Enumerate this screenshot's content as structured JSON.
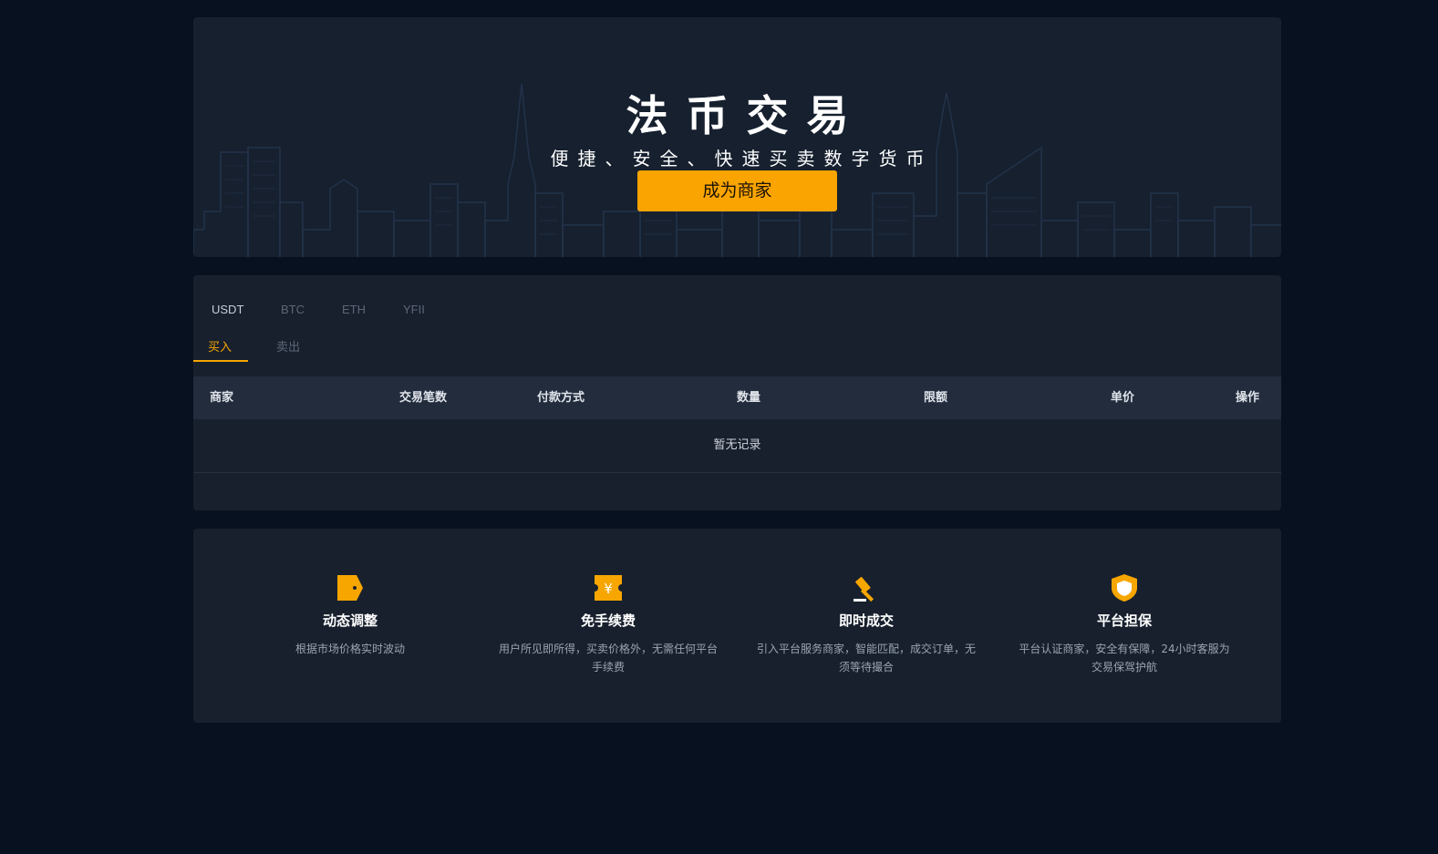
{
  "banner": {
    "title": "法币交易",
    "subtitle": "便捷、安全、快速买卖数字货币",
    "merchant_button": "成为商家"
  },
  "coin_tabs": [
    {
      "label": "USDT",
      "active": true
    },
    {
      "label": "BTC",
      "active": false
    },
    {
      "label": "ETH",
      "active": false
    },
    {
      "label": "YFII",
      "active": false
    }
  ],
  "side_tabs": [
    {
      "label": "买入",
      "active": true
    },
    {
      "label": "卖出",
      "active": false
    }
  ],
  "table": {
    "columns": [
      "商家",
      "交易笔数",
      "付款方式",
      "数量",
      "限额",
      "单价",
      "操作"
    ],
    "empty_text": "暂无记录"
  },
  "features": [
    {
      "icon": "tag-icon",
      "title": "动态调整",
      "desc": "根据市场价格实时波动"
    },
    {
      "icon": "yen-ticket-icon",
      "title": "免手续费",
      "desc": "用户所见即所得，买卖价格外，无需任何平台手续费"
    },
    {
      "icon": "gavel-icon",
      "title": "即时成交",
      "desc": "引入平台服务商家，智能匹配，成交订单，无须等待撮合"
    },
    {
      "icon": "shield-icon",
      "title": "平台担保",
      "desc": "平台认证商家，安全有保障，24小时客服为交易保驾护航"
    }
  ],
  "colors": {
    "page_bg": "#08111f",
    "panel_bg": "#18202e",
    "accent": "#f9a400"
  }
}
